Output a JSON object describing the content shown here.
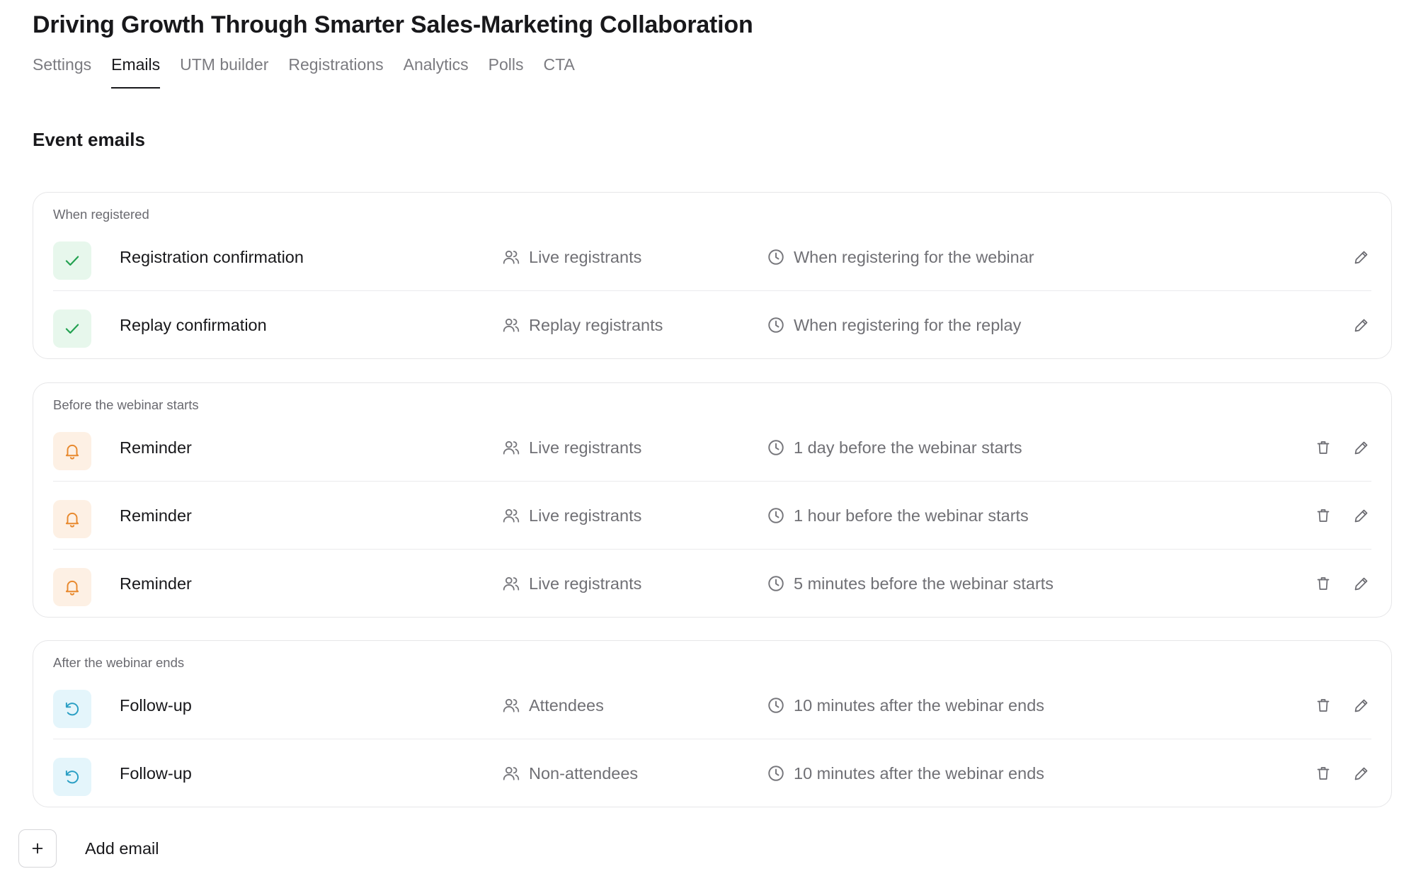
{
  "header": {
    "title": "Driving Growth Through Smarter Sales-Marketing Collaboration"
  },
  "tabs": [
    {
      "label": "Settings",
      "active": false
    },
    {
      "label": "Emails",
      "active": true
    },
    {
      "label": "UTM builder",
      "active": false
    },
    {
      "label": "Registrations",
      "active": false
    },
    {
      "label": "Analytics",
      "active": false
    },
    {
      "label": "Polls",
      "active": false
    },
    {
      "label": "CTA",
      "active": false
    }
  ],
  "section": {
    "title": "Event emails"
  },
  "groups": [
    {
      "label": "When registered",
      "rows": [
        {
          "icon": "check-icon",
          "name": "Registration confirmation",
          "audience": "Live registrants",
          "timing": "When registering for the webinar",
          "deletable": false
        },
        {
          "icon": "check-icon",
          "name": "Replay confirmation",
          "audience": "Replay registrants",
          "timing": "When registering for the replay",
          "deletable": false
        }
      ]
    },
    {
      "label": "Before the webinar starts",
      "rows": [
        {
          "icon": "bell-icon",
          "name": "Reminder",
          "audience": "Live registrants",
          "timing": "1 day before the webinar starts",
          "deletable": true
        },
        {
          "icon": "bell-icon",
          "name": "Reminder",
          "audience": "Live registrants",
          "timing": "1 hour before the webinar starts",
          "deletable": true
        },
        {
          "icon": "bell-icon",
          "name": "Reminder",
          "audience": "Live registrants",
          "timing": "5 minutes before the webinar starts",
          "deletable": true
        }
      ]
    },
    {
      "label": "After the webinar ends",
      "rows": [
        {
          "icon": "undo-arrow-icon",
          "name": "Follow-up",
          "audience": "Attendees",
          "timing": "10 minutes after the webinar ends",
          "deletable": true
        },
        {
          "icon": "undo-arrow-icon",
          "name": "Follow-up",
          "audience": "Non-attendees",
          "timing": "10 minutes after the webinar ends",
          "deletable": true
        }
      ]
    }
  ],
  "add_email": {
    "label": "Add email"
  },
  "colors": {
    "check_bg": "#e7f7ec",
    "check_fg": "#22a150",
    "bell_bg": "#fdf0e4",
    "bell_fg": "#e8892e",
    "undo_bg": "#e4f5fb",
    "undo_fg": "#2a9fc4",
    "meta_icon": "#76767b",
    "action_icon": "#6a6a70"
  }
}
